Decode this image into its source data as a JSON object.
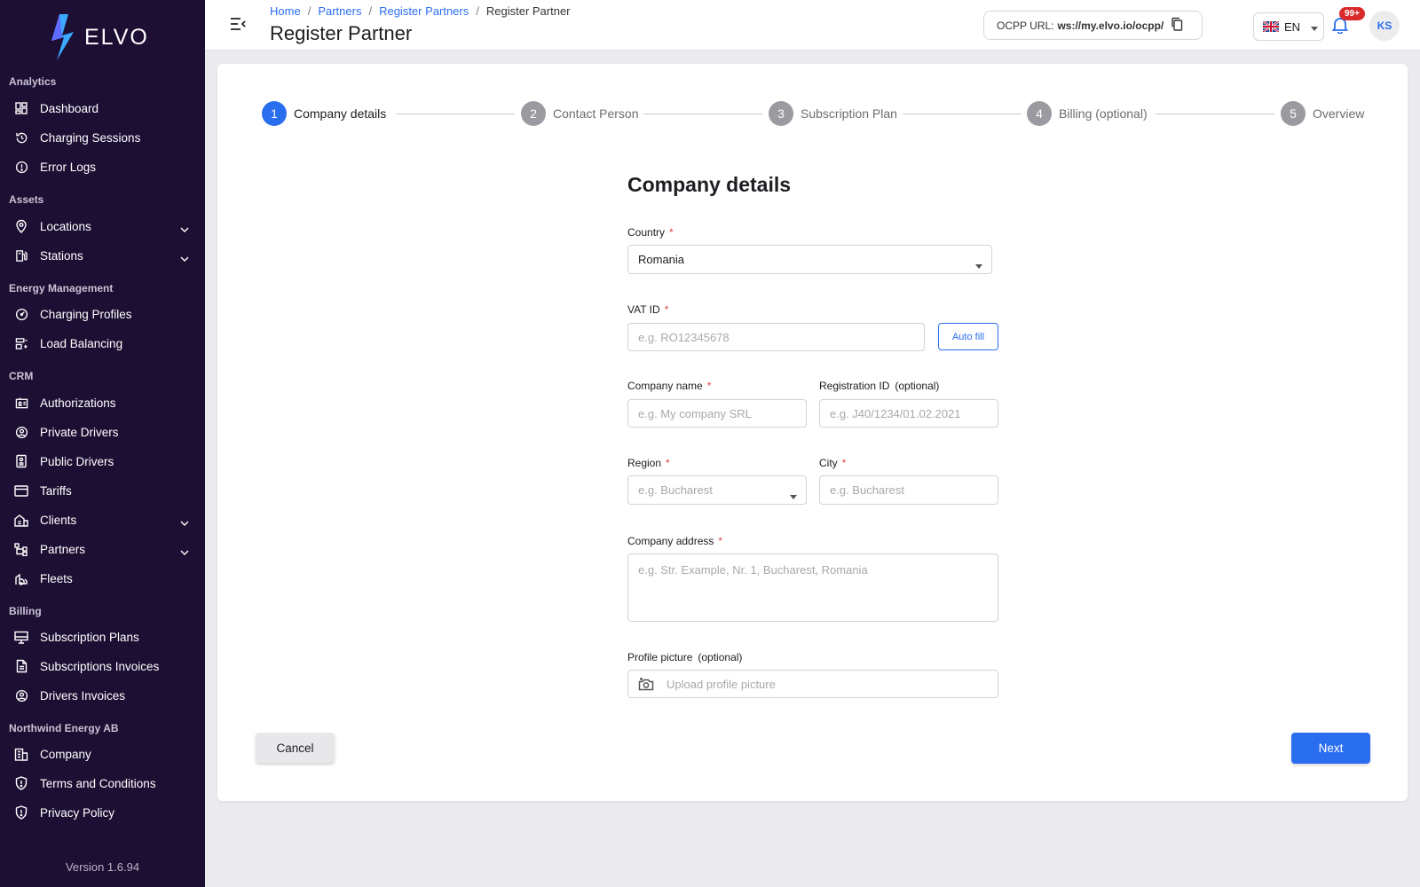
{
  "brand": {
    "name": "ELVO"
  },
  "sidebar": {
    "sections": {
      "analytics": "Analytics",
      "assets": "Assets",
      "energy": "Energy Management",
      "crm": "CRM",
      "billing": "Billing",
      "org": "Northwind Energy AB"
    },
    "items": {
      "dashboard": "Dashboard",
      "charging_sessions": "Charging Sessions",
      "error_logs": "Error Logs",
      "locations": "Locations",
      "stations": "Stations",
      "charging_profiles": "Charging Profiles",
      "load_balancing": "Load Balancing",
      "authorizations": "Authorizations",
      "private_drivers": "Private Drivers",
      "public_drivers": "Public Drivers",
      "tariffs": "Tariffs",
      "clients": "Clients",
      "partners": "Partners",
      "fleets": "Fleets",
      "subscription_plans": "Subscription Plans",
      "subscriptions_invoices": "Subscriptions Invoices",
      "drivers_invoices": "Drivers Invoices",
      "company": "Company",
      "terms": "Terms and Conditions",
      "privacy": "Privacy Policy"
    },
    "version": "Version 1.6.94"
  },
  "header": {
    "breadcrumb": {
      "home": "Home",
      "partners": "Partners",
      "register_partners": "Register Partners",
      "current": "Register Partner"
    },
    "separator": "/",
    "title": "Register Partner",
    "ocpp_label": "OCPP URL:",
    "ocpp_value": "ws://my.elvo.io/ocpp/",
    "language": "EN",
    "notifications_badge": "99+",
    "avatar_initials": "KS"
  },
  "stepper": {
    "steps": [
      {
        "num": "1",
        "label": "Company details"
      },
      {
        "num": "2",
        "label": "Contact Person"
      },
      {
        "num": "3",
        "label": "Subscription Plan"
      },
      {
        "num": "4",
        "label": "Billing (optional)"
      },
      {
        "num": "5",
        "label": "Overview"
      }
    ]
  },
  "form": {
    "title": "Company details",
    "required_mark": "*",
    "country": {
      "label": "Country",
      "value": "Romania"
    },
    "vat": {
      "label": "VAT ID",
      "placeholder": "e.g. RO12345678",
      "autofill": "Auto fill"
    },
    "company_name": {
      "label": "Company name",
      "placeholder": "e.g. My company SRL"
    },
    "registration_id": {
      "label": "Registration ID",
      "optional": "(optional)",
      "placeholder": "e.g. J40/1234/01.02.2021"
    },
    "region": {
      "label": "Region",
      "placeholder": "e.g. Bucharest"
    },
    "city": {
      "label": "City",
      "placeholder": "e.g. Bucharest"
    },
    "address": {
      "label": "Company address",
      "placeholder": "e.g. Str. Example, Nr. 1, Bucharest, Romania"
    },
    "profile_picture": {
      "label": "Profile picture",
      "optional": "(optional)",
      "placeholder": "Upload profile picture"
    }
  },
  "actions": {
    "cancel": "Cancel",
    "next": "Next"
  },
  "colors": {
    "sidebar_bg": "#1d0f33",
    "accent": "#2a6ef0",
    "required": "#e04545",
    "badge": "#d92b2b"
  }
}
